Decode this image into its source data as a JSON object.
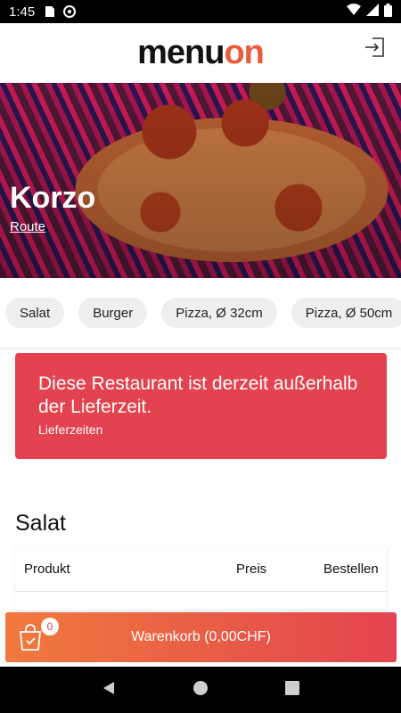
{
  "status_bar": {
    "time": "1:45"
  },
  "header": {
    "logo_prefix": "menu",
    "logo_accent": "on"
  },
  "hero": {
    "title": "Korzo",
    "route_link": "Route"
  },
  "categories": [
    "Salat",
    "Burger",
    "Pizza, Ø 32cm",
    "Pizza, Ø 50cm"
  ],
  "alert": {
    "message": "Diese Restaurant ist derzeit außerhalb der Lieferzeit.",
    "link": "Lieferzeiten"
  },
  "section": {
    "title": "Salat",
    "columns": {
      "product": "Produkt",
      "price": "Preis",
      "order": "Bestellen"
    }
  },
  "cart": {
    "badge_count": "0",
    "label": "Warenkorb (0,00CHF)"
  },
  "colors": {
    "accent": "#e3434f",
    "accent_orange": "#f07a3d",
    "logo_accent": "#ea5b3a"
  },
  "icons": [
    "sim-card-icon",
    "at-sign-icon",
    "wifi-icon",
    "signal-icon",
    "battery-icon",
    "login-icon",
    "shopping-bag-icon",
    "nav-back-icon",
    "nav-home-icon",
    "nav-recents-icon"
  ]
}
